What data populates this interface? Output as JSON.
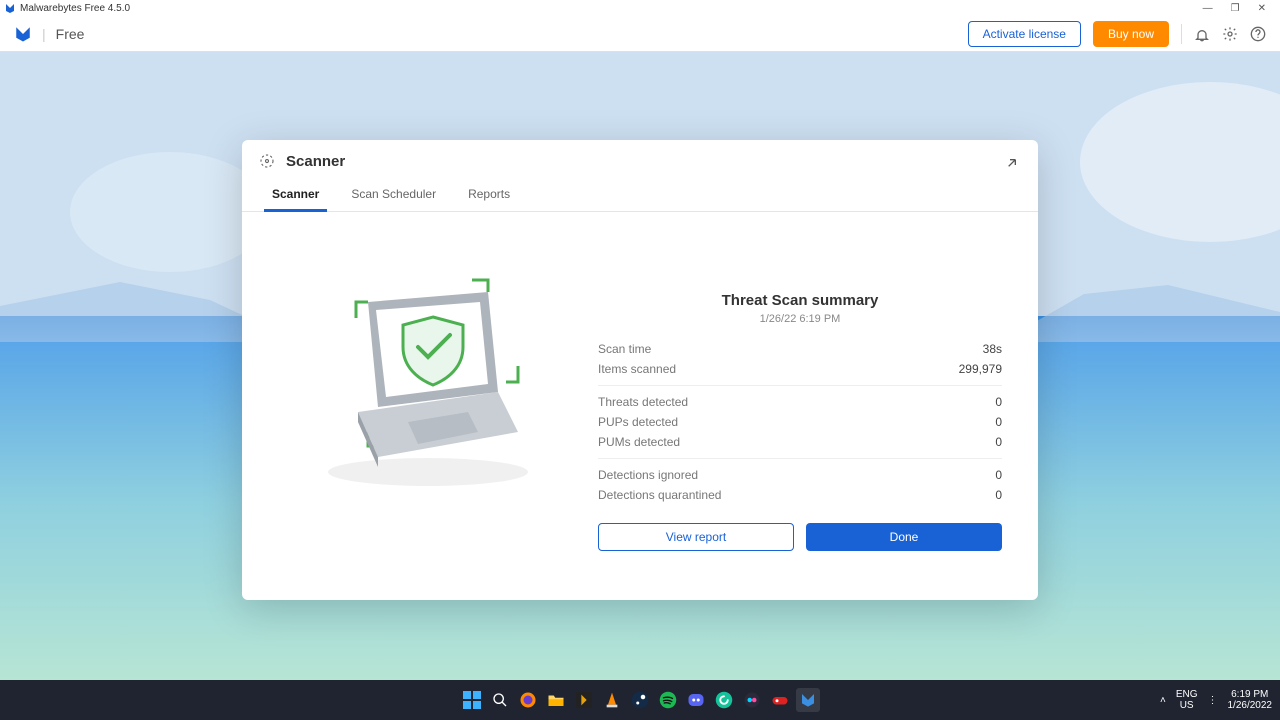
{
  "window": {
    "title": "Malwarebytes Free 4.5.0"
  },
  "header": {
    "tier": "Free",
    "activate": "Activate license",
    "buy": "Buy now"
  },
  "panel": {
    "title": "Scanner",
    "tabs": [
      "Scanner",
      "Scan Scheduler",
      "Reports"
    ],
    "summary_title": "Threat Scan summary",
    "summary_dt": "1/26/22 6:19 PM",
    "group1": [
      {
        "label": "Scan time",
        "value": "38s"
      },
      {
        "label": "Items scanned",
        "value": "299,979"
      }
    ],
    "group2": [
      {
        "label": "Threats detected",
        "value": "0"
      },
      {
        "label": "PUPs detected",
        "value": "0"
      },
      {
        "label": "PUMs detected",
        "value": "0"
      }
    ],
    "group3": [
      {
        "label": "Detections ignored",
        "value": "0"
      },
      {
        "label": "Detections quarantined",
        "value": "0"
      }
    ],
    "view_report": "View report",
    "done": "Done"
  },
  "tray": {
    "lang": "ENG",
    "region": "US",
    "time": "6:19 PM",
    "date": "1/26/2022"
  }
}
